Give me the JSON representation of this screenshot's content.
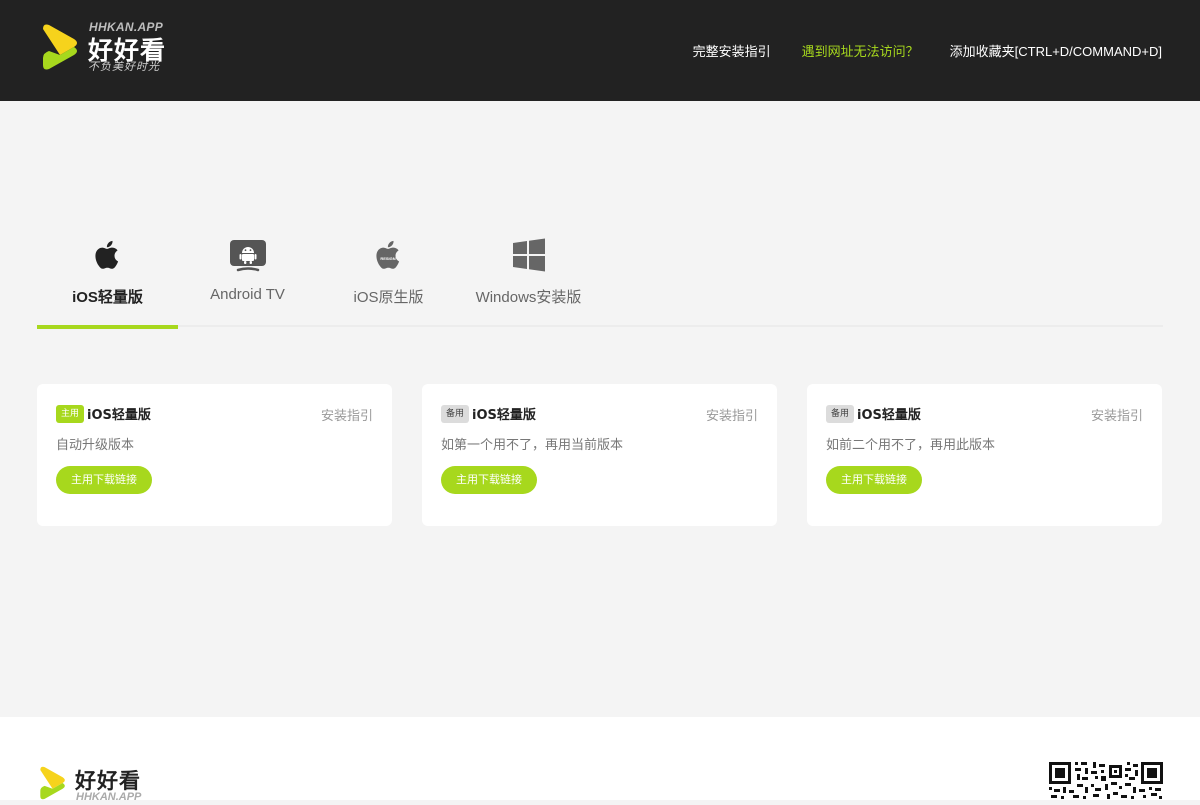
{
  "header": {
    "logo": {
      "domain": "HHKAN.APP",
      "brand": "好好看",
      "slogan": "不负美好时光",
      "colors": {
        "yellow": "#f6d31c",
        "green": "#a7d81d"
      }
    },
    "nav": [
      {
        "label": "完整安装指引"
      },
      {
        "label": "遇到网址无法访问？",
        "accent": "#a7d81d"
      },
      {
        "label": "添加收藏夹[CTRL+D/COMMAND+D]"
      }
    ]
  },
  "tabs": [
    {
      "label": "iOS轻量版",
      "icon": "apple-icon",
      "active": true
    },
    {
      "label": "Android TV",
      "icon": "android-tv-icon",
      "active": false
    },
    {
      "label": "iOS原生版",
      "icon": "apple-resign-icon",
      "icon_text": "RESIGN",
      "active": false
    },
    {
      "label": "Windows安装版",
      "icon": "windows-icon",
      "active": false
    }
  ],
  "cards": [
    {
      "badge": "主用",
      "badge_type": "main",
      "title": "iOS轻量版",
      "guide": "安装指引",
      "desc": "自动升级版本",
      "button": "主用下载链接"
    },
    {
      "badge": "备用",
      "badge_type": "backup",
      "title": "iOS轻量版",
      "guide": "安装指引",
      "desc": "如第一个用不了，再用当前版本",
      "button": "主用下载链接"
    },
    {
      "badge": "备用",
      "badge_type": "backup",
      "title": "iOS轻量版",
      "guide": "安装指引",
      "desc": "如前二个用不了，再用此版本",
      "button": "主用下载链接"
    }
  ],
  "footer": {
    "logo": {
      "brand": "好好看",
      "domain": "HHKAN.APP"
    },
    "qr_icon": "qr-code-icon"
  },
  "theme": {
    "accent": "#a7d81d",
    "header_bg": "#222222",
    "page_bg": "#f4f4f4"
  }
}
